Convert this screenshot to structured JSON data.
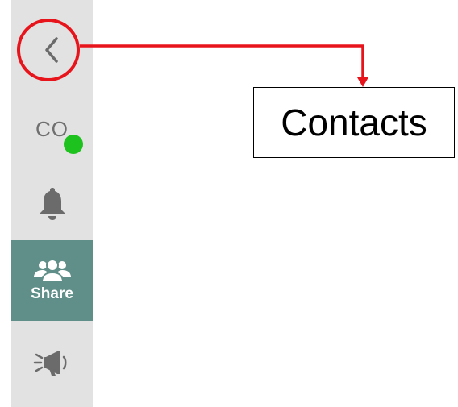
{
  "sidebar": {
    "back_icon": "chevron-left-icon",
    "user_initials": "CO",
    "presence_status_color": "#1ec21e",
    "notification_icon": "bell-icon",
    "share_icon": "people-group-icon",
    "share_label": "Share",
    "share_bg_color": "#5f8f88",
    "announce_icon": "megaphone-icon"
  },
  "annotation": {
    "callout_label": "Contacts",
    "highlight_color": "#e8141c"
  }
}
